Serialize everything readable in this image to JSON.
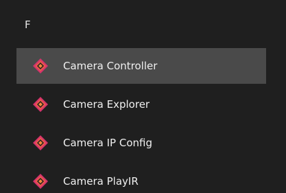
{
  "group": {
    "letter": "F"
  },
  "apps": [
    {
      "label": "Camera Controller",
      "icon": "camera-app-icon",
      "selected": true
    },
    {
      "label": "Camera Explorer",
      "icon": "camera-app-icon",
      "selected": false
    },
    {
      "label": "Camera IP Config",
      "icon": "camera-app-icon",
      "selected": false
    },
    {
      "label": "Camera PlayIR",
      "icon": "camera-app-icon",
      "selected": false
    }
  ],
  "colors": {
    "background": "#1f1f1f",
    "selected_row": "#4a4a4a",
    "icon_outer": "#e8594a",
    "icon_inner": "#f08a3c",
    "icon_accent": "#d6336c"
  }
}
